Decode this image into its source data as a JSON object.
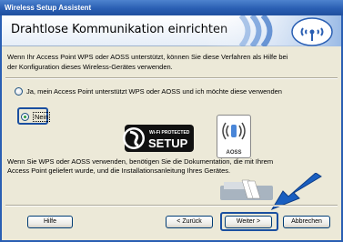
{
  "window": {
    "title": "Wireless Setup Assistent"
  },
  "header": {
    "title": "Drahtlose Kommunikation einrichten"
  },
  "intro": {
    "line1": "Wenn Ihr Access Point WPS oder AOSS unterstützt, können Sie diese Verfahren als Hilfe bei",
    "line2": "der Konfiguration dieses Wireless-Gerätes verwenden."
  },
  "options": {
    "yes_label": "Ja, mein Access Point unterstützt WPS oder AOSS und ich möchte diese verwenden",
    "no_label": "Nein",
    "selected": "Nein"
  },
  "logos": {
    "wps_small": "Wi-Fi PROTECTED",
    "wps_big": "SETUP",
    "aoss": "AOSS"
  },
  "note": {
    "line1": "Wenn Sie WPS oder AOSS verwenden, benötigen Sie die Dokumentation, die mit Ihrem",
    "line2": "Access Point geliefert wurde, und die Installationsanleitung Ihres Gerätes."
  },
  "buttons": {
    "help": "Hilfe",
    "back": "< Zurück",
    "next": "Weiter >",
    "cancel": "Abbrechen"
  },
  "icons": {
    "wireless": "wireless-signal-icon",
    "arrow": "blue-arrow-icon"
  }
}
